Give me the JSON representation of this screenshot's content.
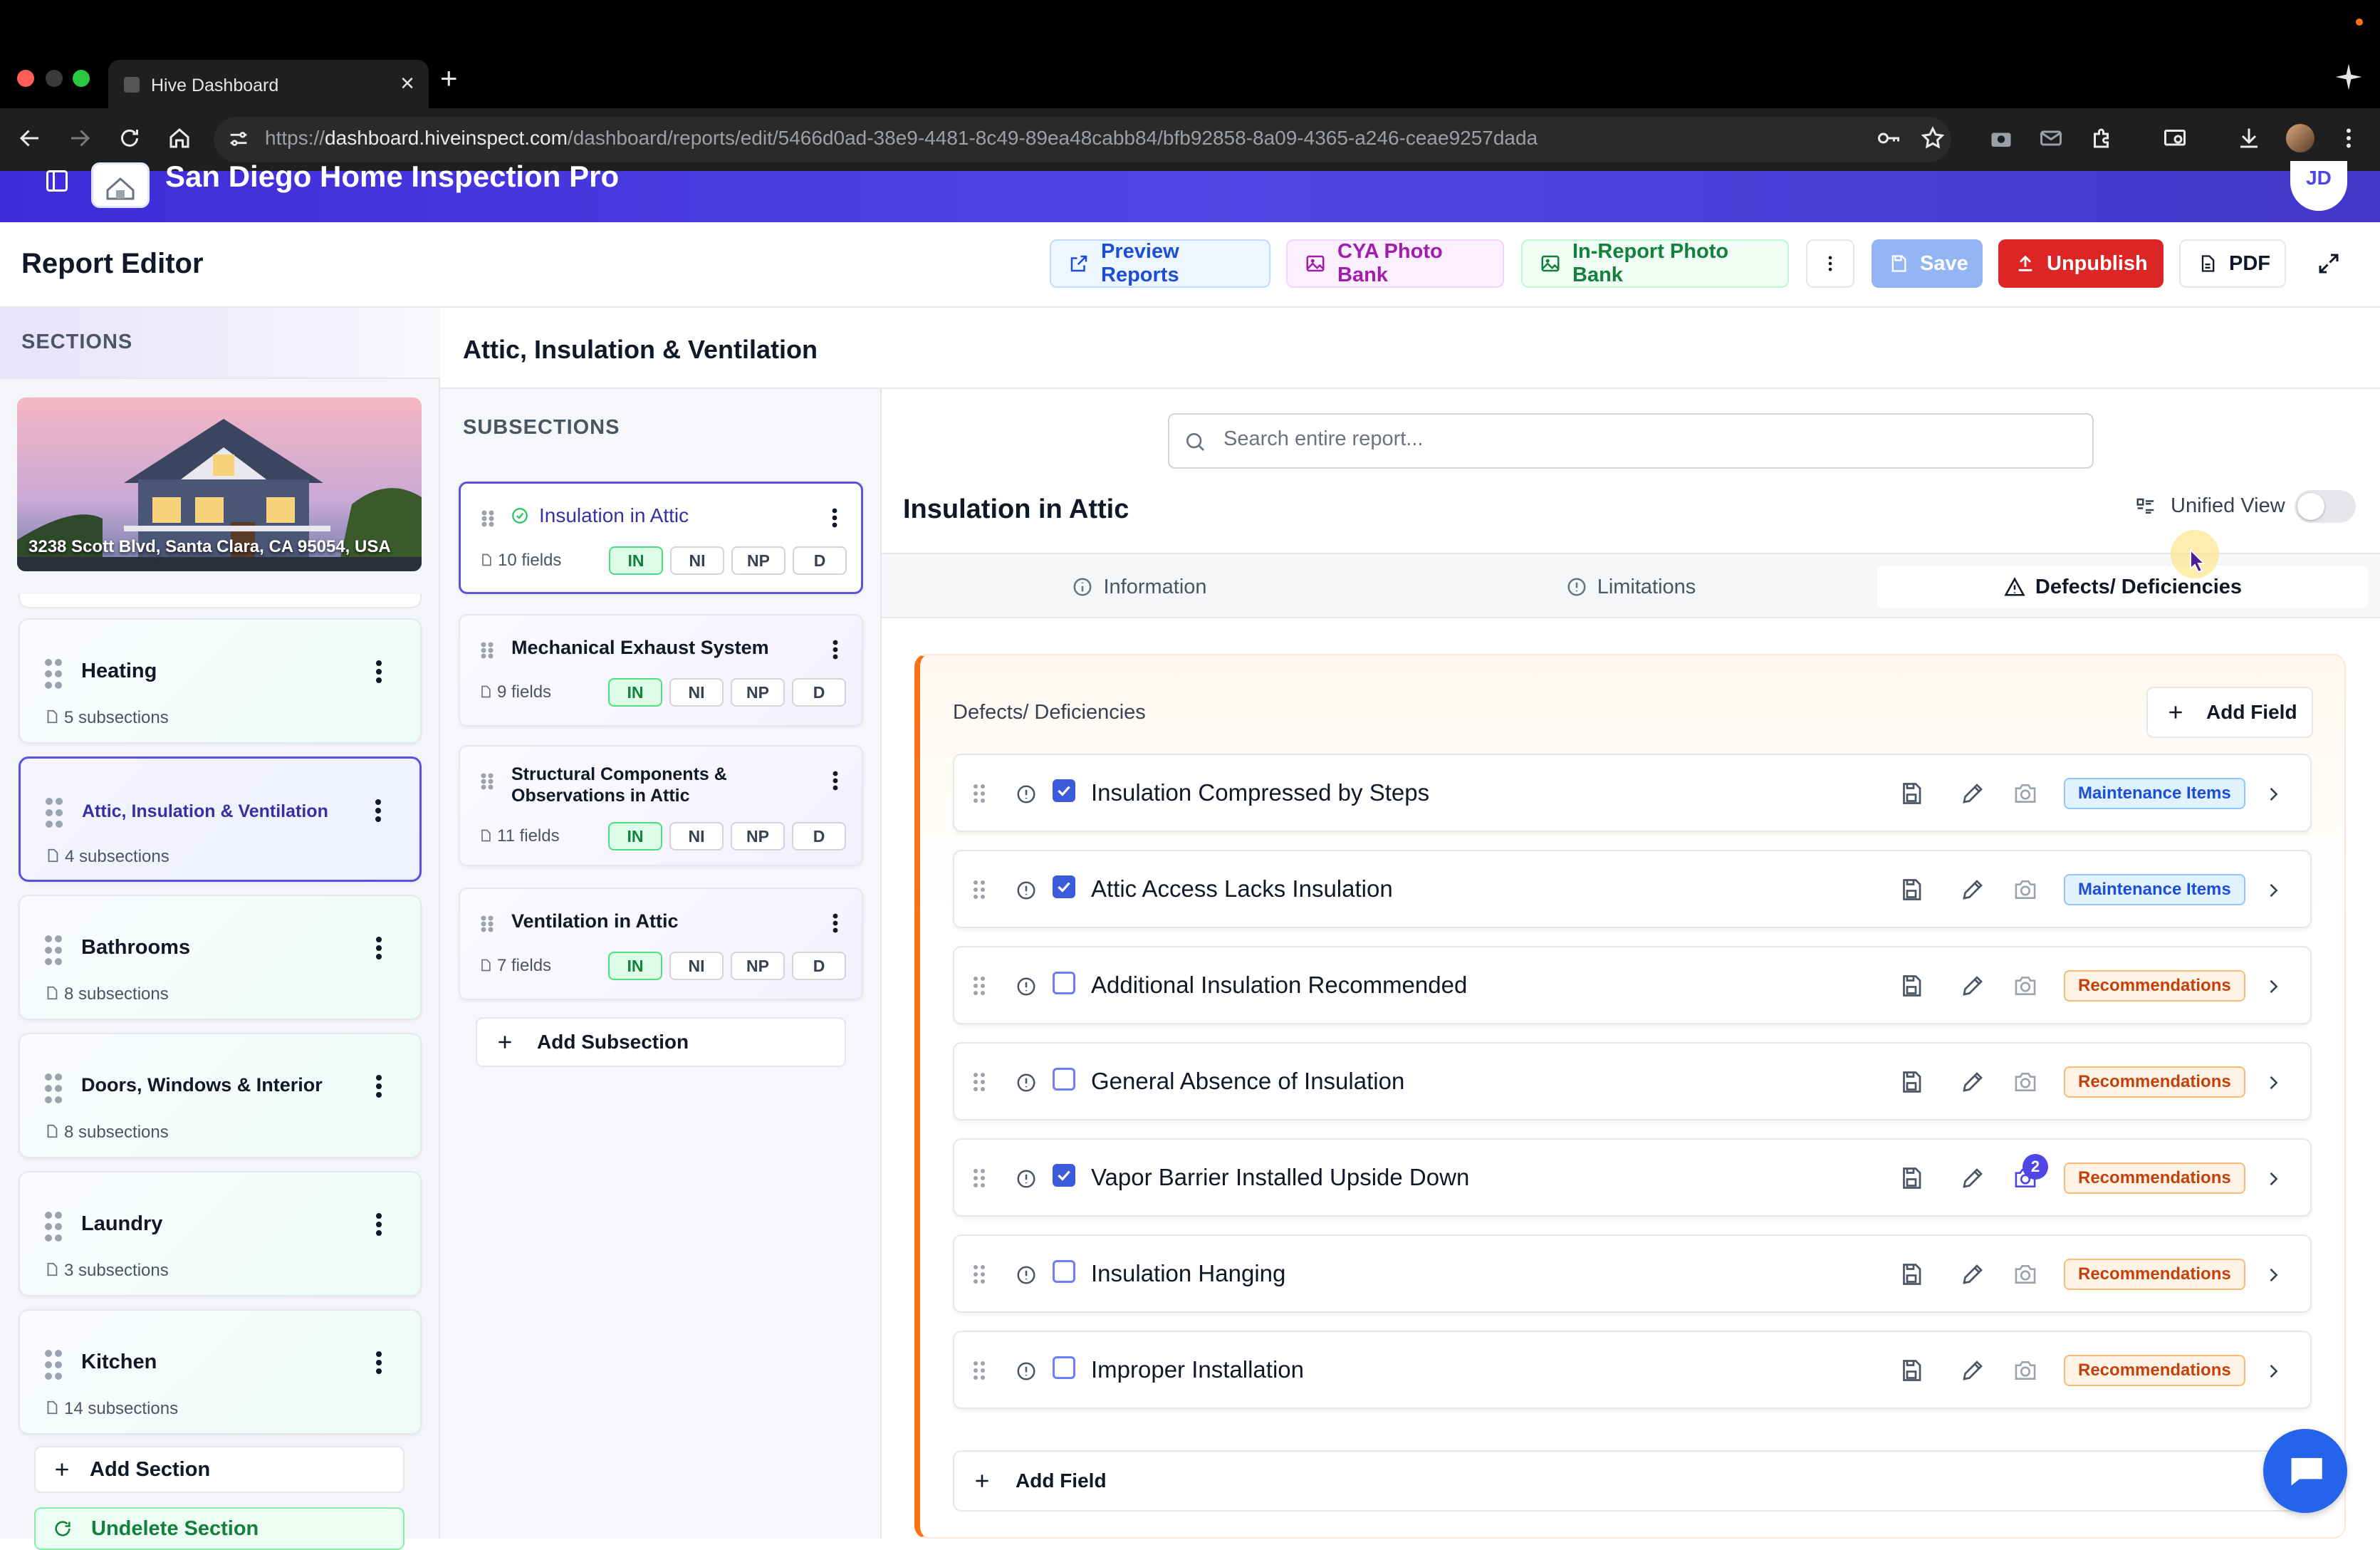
{
  "browser": {
    "tab_title": "Hive Dashboard",
    "url_scheme": "https://",
    "url_host": "dashboard.hiveinspect.com",
    "url_path": "/dashboard/reports/edit/5466d0ad-38e9-4481-8c49-89ea48cabb84/bfb92858-8a09-4365-a246-ceae9257dada"
  },
  "app": {
    "company_name": "San Diego Home Inspection Pro",
    "avatar_initials": "JD",
    "accent": "#4f46e5"
  },
  "toolbar": {
    "title": "Report Editor",
    "preview_label": "Preview Reports",
    "cya_label": "CYA Photo Bank",
    "inreport_label": "In-Report Photo Bank",
    "save_label": "Save",
    "unpublish_label": "Unpublish",
    "pdf_label": "PDF"
  },
  "sections_panel": {
    "title": "SECTIONS",
    "property_address": "3238 Scott Blvd, Santa Clara, CA 95054, USA",
    "items": [
      {
        "name": "Heating",
        "subsections": "5 subsections"
      },
      {
        "name": "Attic, Insulation & Ventilation",
        "subsections": "4 subsections",
        "active": true
      },
      {
        "name": "Bathrooms",
        "subsections": "8 subsections"
      },
      {
        "name": "Doors, Windows & Interior",
        "subsections": "8 subsections"
      },
      {
        "name": "Laundry",
        "subsections": "3 subsections"
      },
      {
        "name": "Kitchen",
        "subsections": "14 subsections"
      }
    ],
    "add_section_label": "Add Section",
    "undelete_label": "Undelete Section"
  },
  "section_title": "Attic, Insulation & Ventilation",
  "subsections_panel": {
    "title": "SUBSECTIONS",
    "items": [
      {
        "name": "Insulation in Attic",
        "fields": "10 fields"
      },
      {
        "name": "Mechanical Exhaust System",
        "fields": "9 fields"
      },
      {
        "name_line1": "Structural Components &",
        "name_line2": "Observations in Attic",
        "fields": "11 fields"
      },
      {
        "name": "Ventilation in Attic",
        "fields": "7 fields"
      }
    ],
    "pills": [
      "IN",
      "NI",
      "NP",
      "D"
    ],
    "add_subsection_label": "Add Subsection"
  },
  "main": {
    "search_placeholder": "Search entire report...",
    "subsection_title": "Insulation in Attic",
    "unified_view_label": "Unified View",
    "tabs": [
      {
        "label": "Information"
      },
      {
        "label": "Limitations"
      },
      {
        "label": "Defects/ Deficiencies",
        "active": true
      }
    ],
    "defects": {
      "title": "Defects/ Deficiencies",
      "add_field_label": "Add Field",
      "rows": [
        {
          "label": "Insulation Compressed by Steps",
          "checked": true,
          "category": "Maintenance Items"
        },
        {
          "label": "Attic Access Lacks Insulation",
          "checked": true,
          "category": "Maintenance Items"
        },
        {
          "label": "Additional Insulation Recommended",
          "checked": false,
          "category": "Recommendations"
        },
        {
          "label": "General Absence of Insulation",
          "checked": false,
          "category": "Recommendations"
        },
        {
          "label": "Vapor Barrier Installed Upside Down",
          "checked": true,
          "category": "Recommendations",
          "photo_count": "2"
        },
        {
          "label": "Insulation Hanging",
          "checked": false,
          "category": "Recommendations"
        },
        {
          "label": "Improper Installation",
          "checked": false,
          "category": "Recommendations"
        }
      ]
    }
  },
  "icons": [
    "search-icon",
    "grip-icon",
    "kebab-menu-icon",
    "info-icon",
    "save-icon",
    "pencil-icon",
    "camera-icon",
    "chevron-right-icon",
    "plus-icon",
    "warning-icon",
    "chat-icon",
    "file-icon",
    "image-icon",
    "external-link-icon",
    "upload-icon",
    "expand-icon"
  ]
}
